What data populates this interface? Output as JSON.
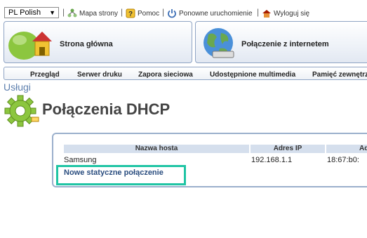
{
  "topbar": {
    "language": "PL Polish",
    "links": [
      "Mapa strony",
      "Pomoc",
      "Ponowne uruchomienie",
      "Wyloguj się"
    ],
    "separator": "|"
  },
  "panels": [
    {
      "label": "Strona główna",
      "icon": "house-icon"
    },
    {
      "label": "Połączenie z internetem",
      "icon": "globe-icon"
    }
  ],
  "subnav": [
    "Przegląd",
    "Serwer druku",
    "Zapora sieciowa",
    "Udostępnione multimedia",
    "Pamięć zewnętrzna"
  ],
  "section": "Usługi",
  "page_title": "Połączenia DHCP",
  "table": {
    "headers": [
      "Nazwa hosta",
      "Adres IP",
      "Ad"
    ],
    "rows": [
      [
        "Samsung",
        "192.168.1.1",
        "18:67:b0:"
      ]
    ]
  },
  "new_connection_link": "Nowe statyczne połączenie",
  "colors": {
    "highlight": "#1fc4a4",
    "accent_blue": "#5d7fae",
    "header_bg": "#d5dfed",
    "panel_border": "#8fa4c4",
    "gear_green": "#8cc63f"
  }
}
